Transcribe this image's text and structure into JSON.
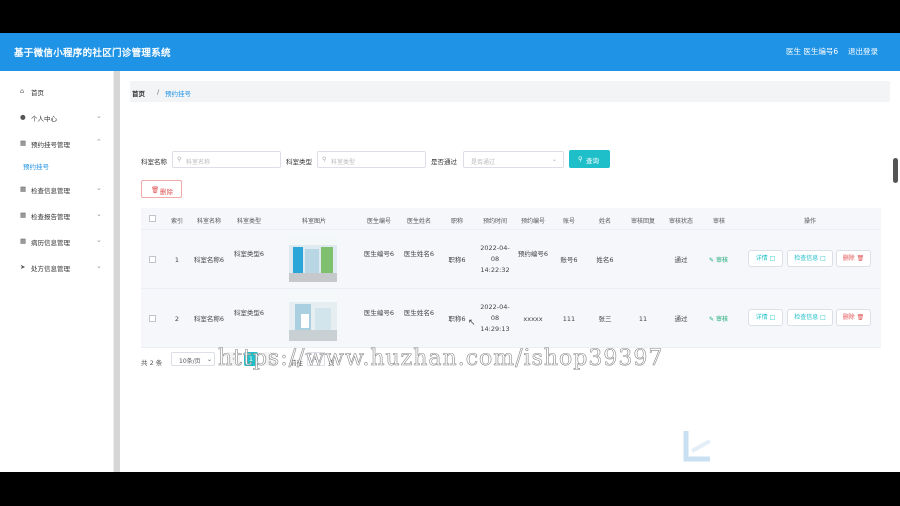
{
  "header": {
    "title": "基于微信小程序的社区门诊管理系统",
    "user": "医生 医生编号6",
    "logout": "退出登录"
  },
  "sidebar": {
    "items": [
      {
        "label": "首页",
        "icon": "home-icon"
      },
      {
        "label": "个人中心",
        "icon": "user-icon"
      },
      {
        "label": "预约挂号管理",
        "icon": "grid-icon"
      },
      {
        "label": "检查信息管理",
        "icon": "grid-icon"
      },
      {
        "label": "检查报告管理",
        "icon": "grid-icon"
      },
      {
        "label": "病历信息管理",
        "icon": "grid-icon"
      },
      {
        "label": "处方信息管理",
        "icon": "send-icon"
      }
    ],
    "sub_active": "预约挂号"
  },
  "breadcrumb": {
    "home": "首页",
    "sep": "/",
    "current": "预约挂号"
  },
  "filters": {
    "dept_name_label": "科室名称",
    "dept_name_placeholder": "科室名称",
    "dept_type_label": "科室类型",
    "dept_type_placeholder": "科室类型",
    "approved_label": "是否通过",
    "approved_placeholder": "是否通过",
    "search_btn": "查询"
  },
  "delete_btn": "删除",
  "table": {
    "headers": [
      "索引",
      "科室名称",
      "科室类型",
      "科室图片",
      "医生编号",
      "医生姓名",
      "职称",
      "预约时间",
      "预约编号",
      "账号",
      "姓名",
      "审核回复",
      "审核状态",
      "审核",
      "操作"
    ],
    "rows": [
      {
        "index": "1",
        "dept_name": "科室名称6",
        "dept_type": "科室类型6",
        "doctor_no": "医生编号6",
        "doctor_name": "医生姓名6",
        "title": "职称6",
        "time": "2022-04-08 14:22:32",
        "appt_no": "预约编号6",
        "account": "账号6",
        "name": "姓名6",
        "reply": "",
        "status": "通过",
        "audit": "审核"
      },
      {
        "index": "2",
        "dept_name": "科室名称6",
        "dept_type": "科室类型6",
        "doctor_no": "医生编号6",
        "doctor_name": "医生姓名6",
        "title": "职称6",
        "time": "2022-04-08 14:29:13",
        "appt_no": "xxxxx",
        "account": "111",
        "name": "张三",
        "reply": "11",
        "status": "通过",
        "audit": "审核"
      }
    ],
    "actions": {
      "detail": "详情",
      "check": "检查信息",
      "delete": "删除"
    }
  },
  "pagination": {
    "total": "共 2 条",
    "page_size": "10条/页",
    "current": "1",
    "goto": "前往",
    "goto_value": "1",
    "page": "页"
  },
  "watermark": "https://www.huzhan.com/ishop39397",
  "colors": {
    "accent": "#1f93e6",
    "teal": "#1fbfc9",
    "danger": "#e05252"
  }
}
